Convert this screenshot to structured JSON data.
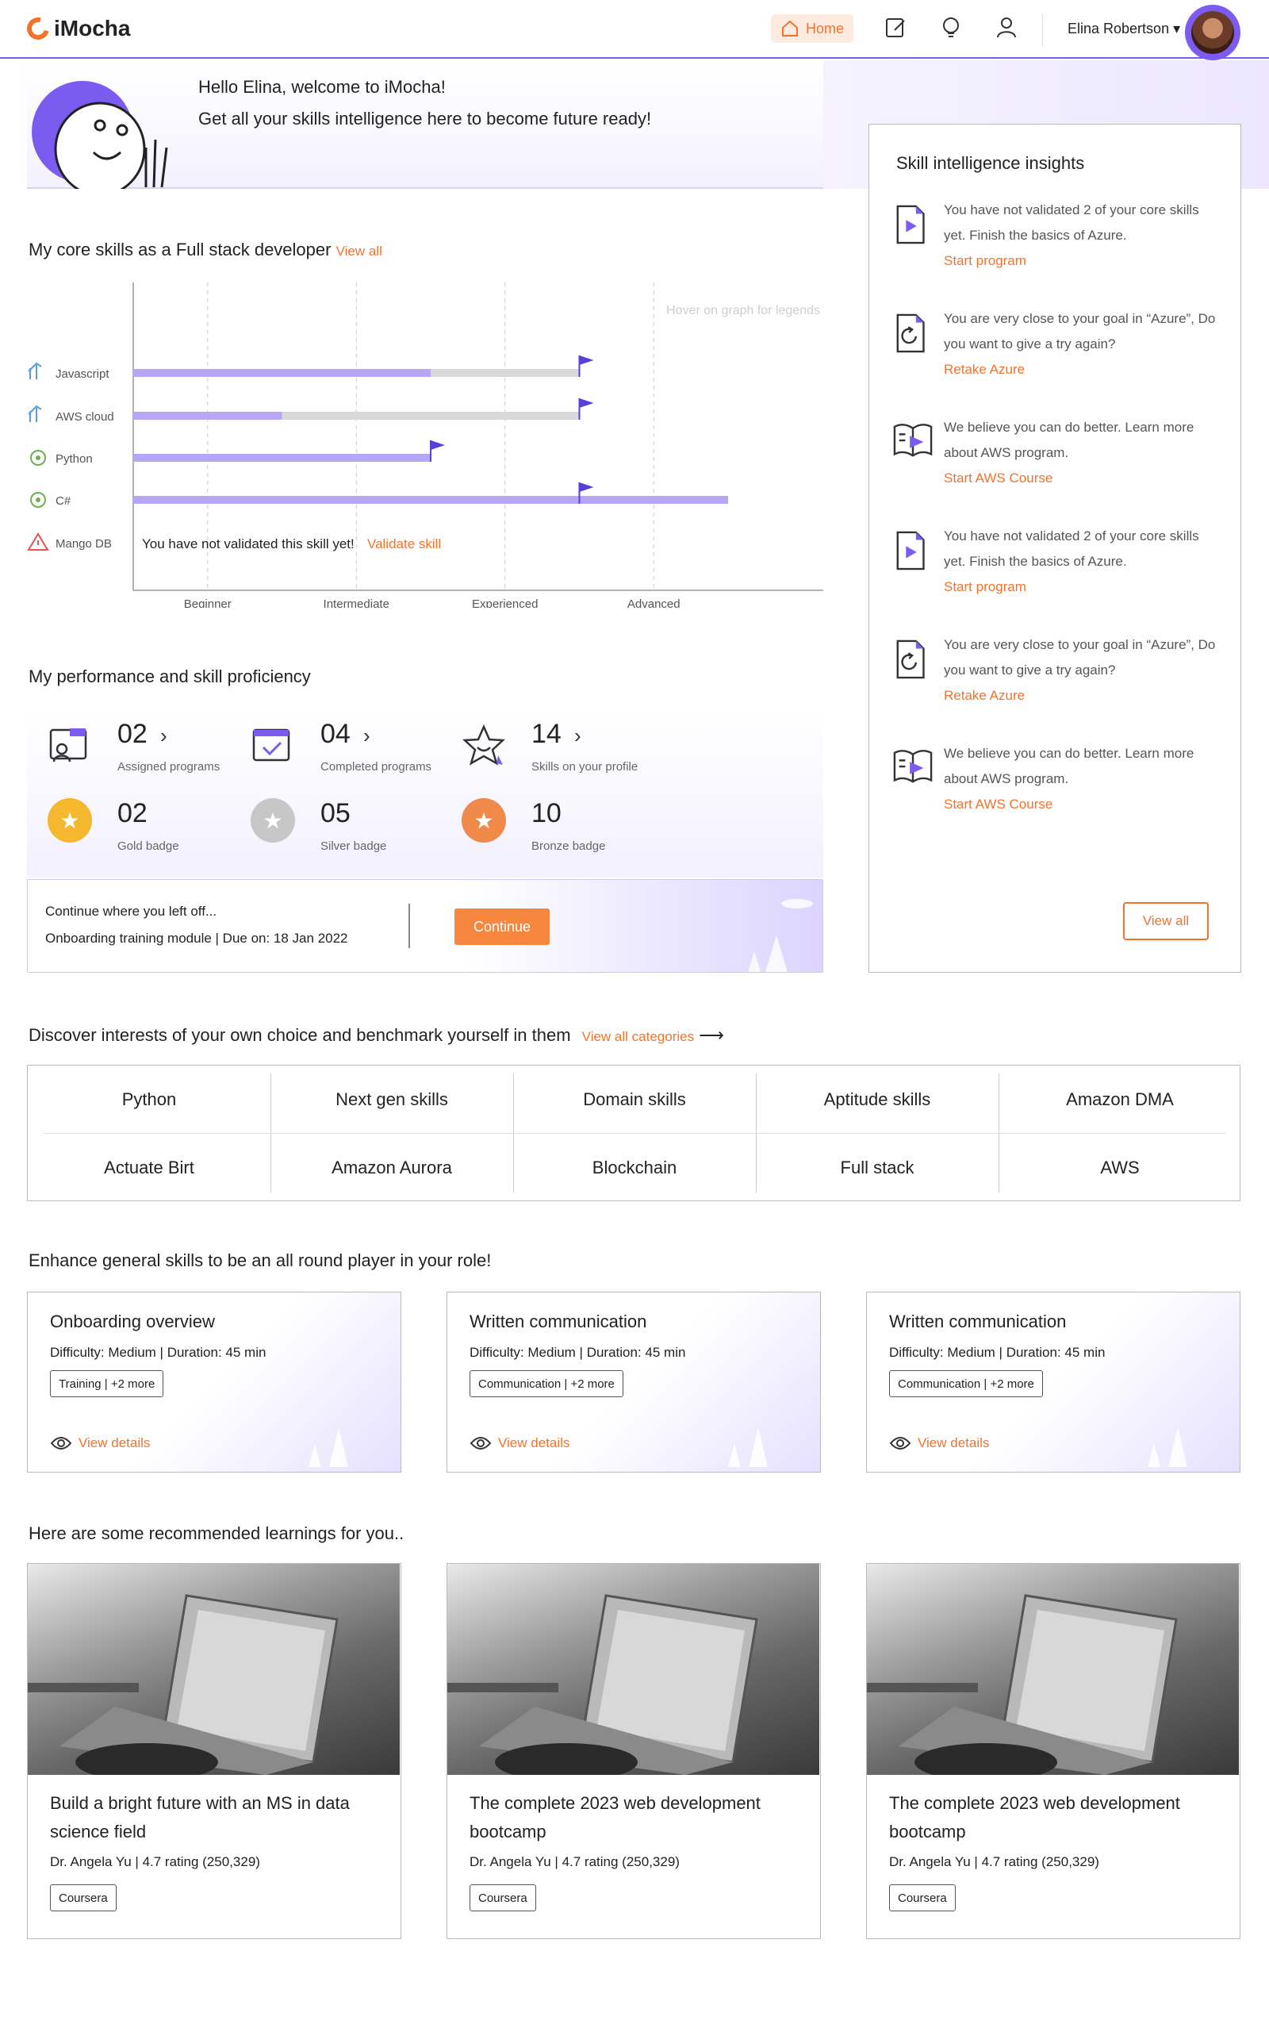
{
  "app": {
    "logo": "iMocha"
  },
  "header": {
    "home_label": "Home",
    "username": "Elina Robertson"
  },
  "welcome": {
    "line1": "Hello Elina, welcome to iMocha!",
    "line2": "Get all your skills intelligence here to become future ready!"
  },
  "core_skills": {
    "title": "My core skills as a Full stack developer",
    "view_all": "View all",
    "hint": "Hover on graph for legends",
    "not_validated_msg": "You have not validated this skill yet!",
    "validate_link": "Validate skill"
  },
  "chart_data": {
    "type": "bar",
    "orientation": "horizontal",
    "x_levels": [
      "Beginner",
      "Intermediate",
      "Experienced",
      "Advanced"
    ],
    "categories": [
      "Javascript",
      "AWS cloud",
      "Python",
      "C#",
      "Mango DB"
    ],
    "series": [
      {
        "values": [
          2,
          1,
          2,
          4,
          null
        ]
      },
      {
        "values": [
          3,
          3,
          null,
          null,
          null
        ]
      }
    ],
    "goal": [
      3,
      3,
      2,
      3,
      null
    ]
  },
  "performance": {
    "title": "My performance and skill proficiency",
    "stats": [
      {
        "num": "02",
        "label": "Assigned programs"
      },
      {
        "num": "04",
        "label": "Completed programs"
      },
      {
        "num": "14",
        "label": "Skills on your profile"
      }
    ],
    "badges": [
      {
        "num": "02",
        "label": "Gold badge",
        "color": "#f5b82e"
      },
      {
        "num": "05",
        "label": "Silver badge",
        "color": "#c7c7c7"
      },
      {
        "num": "10",
        "label": "Bronze badge",
        "color": "#f08a4b"
      }
    ],
    "continue": {
      "line1": "Continue where you left off...",
      "line2": "Onboarding training module  |  Due on: 18 Jan 2022",
      "button": "Continue"
    }
  },
  "insights": {
    "title": "Skill intelligence insights",
    "items": [
      {
        "icon": "play-doc-icon",
        "text": "You have not validated 2 of your core skills yet. Finish the basics of Azure.",
        "link": "Start program"
      },
      {
        "icon": "retry-doc-icon",
        "text": "You are very close to your goal in “Azure”, Do you want to give a try again?",
        "link": "Retake Azure"
      },
      {
        "icon": "book-play-icon",
        "text": "We believe you can do better. Learn more about AWS program.",
        "link": "Start AWS Course"
      },
      {
        "icon": "play-doc-icon",
        "text": "You have not validated 2 of your core skills yet. Finish the basics of Azure.",
        "link": "Start program"
      },
      {
        "icon": "retry-doc-icon",
        "text": "You are very close to your goal in “Azure”, Do you want to give a try again?",
        "link": "Retake Azure"
      },
      {
        "icon": "book-play-icon",
        "text": "We believe you can do better. Learn more about AWS program.",
        "link": "Start AWS Course"
      }
    ],
    "view_all": "View all"
  },
  "interests": {
    "title": "Discover interests of your own choice and benchmark yourself in them",
    "view_all": "View all categories",
    "categories": [
      "Python",
      "Next gen skills",
      "Domain skills",
      "Aptitude skills",
      "Amazon DMA",
      "Actuate Birt",
      "Amazon Aurora",
      "Blockchain",
      "Full stack",
      "AWS"
    ]
  },
  "general": {
    "title": "Enhance general skills to be an all round player in your role!",
    "cards": [
      {
        "title": "Onboarding overview",
        "meta": "Difficulty: Medium  |  Duration: 45 min",
        "tag": "Training  |  +2 more",
        "link": "View details"
      },
      {
        "title": "Written  communication",
        "meta": "Difficulty: Medium  |  Duration: 45 min",
        "tag": "Communication  |  +2 more",
        "link": "View details"
      },
      {
        "title": "Written  communication",
        "meta": "Difficulty: Medium  |  Duration: 45 min",
        "tag": "Communication  |  +2 more",
        "link": "View details"
      }
    ]
  },
  "recommended": {
    "title": "Here are some recommended learnings for you..",
    "cards": [
      {
        "title": "Build a bright future with an MS in data science field",
        "author": "Dr. Angela Yu  |  4.7 rating (250,329)",
        "tag": "Coursera"
      },
      {
        "title": "The complete 2023 web development bootcamp",
        "author": "Dr. Angela Yu  |  4.7 rating (250,329)",
        "tag": "Coursera"
      },
      {
        "title": "The complete 2023 web development bootcamp",
        "author": "Dr. Angela Yu  |  4.7 rating (250,329)",
        "tag": "Coursera"
      }
    ]
  },
  "colors": {
    "accent": "#f4722b",
    "brand": "#7c5cf0",
    "bar_primary": "#b7a6f5",
    "bar_secondary": "#d9d9d9"
  }
}
